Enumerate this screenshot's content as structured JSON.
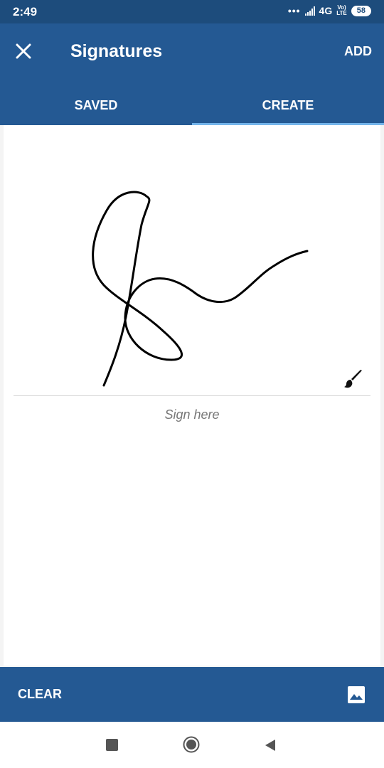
{
  "status_bar": {
    "time": "2:49",
    "dots": "•••",
    "network": "4G",
    "volte_top": "Vo)",
    "volte_bottom": "LTE",
    "battery": "58"
  },
  "app_bar": {
    "title": "Signatures",
    "add_label": "ADD",
    "close_icon": "close-icon"
  },
  "tabs": [
    {
      "label": "SAVED",
      "active": false
    },
    {
      "label": "CREATE",
      "active": true
    }
  ],
  "canvas": {
    "hint": "Sign here",
    "brush_icon": "brush-icon"
  },
  "bottom_bar": {
    "clear_label": "CLEAR",
    "image_icon": "image-icon"
  },
  "nav": {
    "recents_icon": "square-icon",
    "home_icon": "circle-icon",
    "back_icon": "back-triangle-icon"
  },
  "colors": {
    "status_bar": "#1d4c7c",
    "primary": "#245993",
    "tab_indicator": "#73b4ea",
    "hint_text": "#777777"
  }
}
